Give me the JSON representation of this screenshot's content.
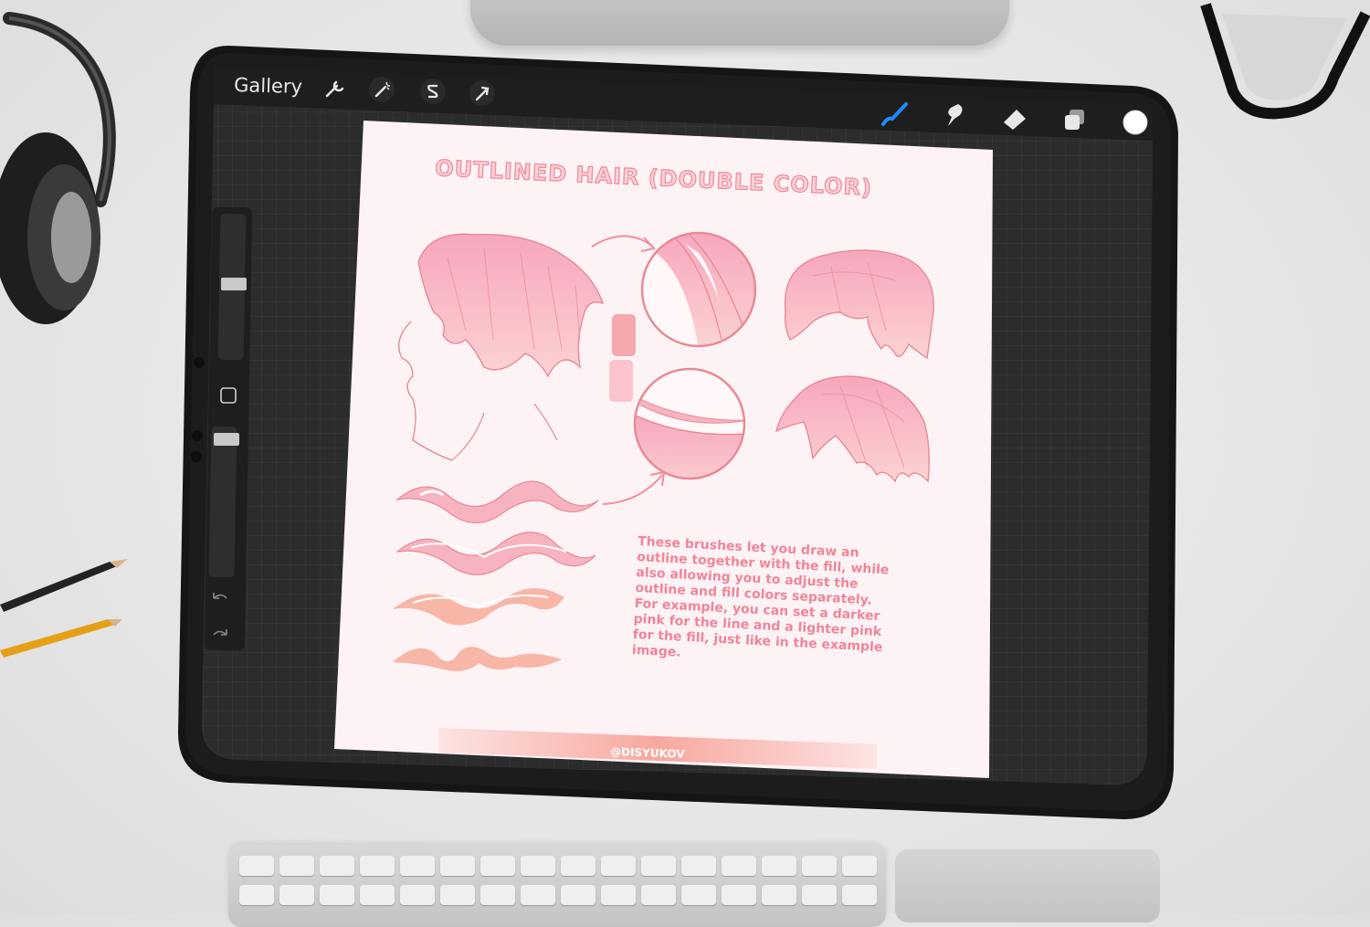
{
  "app": {
    "gallery_label": "Gallery"
  },
  "toolbar_left": [
    {
      "name": "actions",
      "icon": "wrench-icon"
    },
    {
      "name": "adjustments",
      "icon": "magic-wand-icon"
    },
    {
      "name": "selection",
      "icon": "selection-s-icon"
    },
    {
      "name": "transform",
      "icon": "arrow-cursor-icon"
    }
  ],
  "toolbar_right": [
    {
      "name": "brush",
      "icon": "brush-icon",
      "active": true
    },
    {
      "name": "smudge",
      "icon": "smudge-icon",
      "active": false
    },
    {
      "name": "eraser",
      "icon": "eraser-icon",
      "active": false
    },
    {
      "name": "layers",
      "icon": "layers-icon",
      "active": false
    },
    {
      "name": "color",
      "icon": "color-swatch-icon",
      "active": false
    }
  ],
  "canvas": {
    "title": "OUTLINED HAIR (DOUBLE COLOR)",
    "description_lines": [
      "These brushes let you draw an",
      "outline together with the fill, while",
      "also allowing you to adjust the",
      "outline and fill colors separately.",
      "For example, you can set a darker",
      "pink for the line and a lighter pink",
      "for the fill, just like in the example",
      "image."
    ],
    "credit": "@DISYUKOV"
  },
  "colors": {
    "accent_pink": "#f0859a",
    "outline_pink": "#e88a96",
    "fill_pink": "#f7b3bf",
    "swatch_dark": "#f5a8ae",
    "swatch_light": "#fbc3cb",
    "active_tool_blue": "#1a8cff",
    "ui_dark": "#1c1c1c",
    "grid_bg": "#2c2c2c"
  }
}
